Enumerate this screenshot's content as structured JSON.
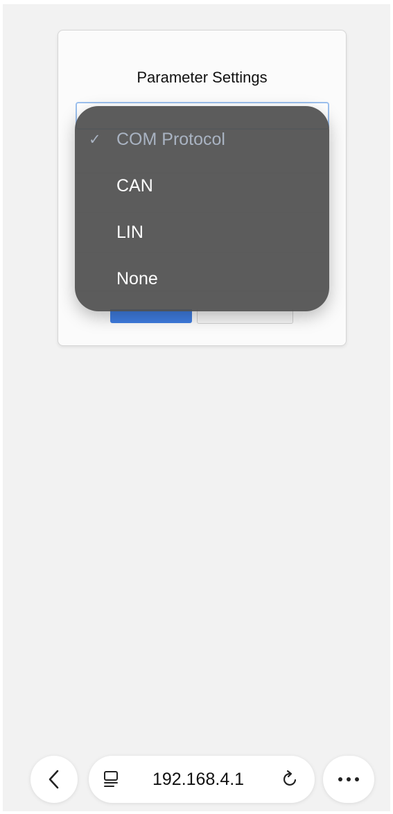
{
  "card": {
    "title": "Parameter Settings"
  },
  "dropdown": {
    "options": [
      {
        "label": "COM Protocol",
        "selected": true,
        "check": "✓"
      },
      {
        "label": "CAN",
        "selected": false
      },
      {
        "label": "LIN",
        "selected": false
      },
      {
        "label": "None",
        "selected": false
      }
    ]
  },
  "browser": {
    "url": "192.168.4.1",
    "icons": {
      "back": "chevron-left-icon",
      "tabs": "tab-overview-icon",
      "reload": "reload-icon",
      "more": "more-icon"
    }
  },
  "colors": {
    "accent": "#3f7de0",
    "dropdown_bg": "#505050",
    "page_bg": "#f2f2f2"
  }
}
